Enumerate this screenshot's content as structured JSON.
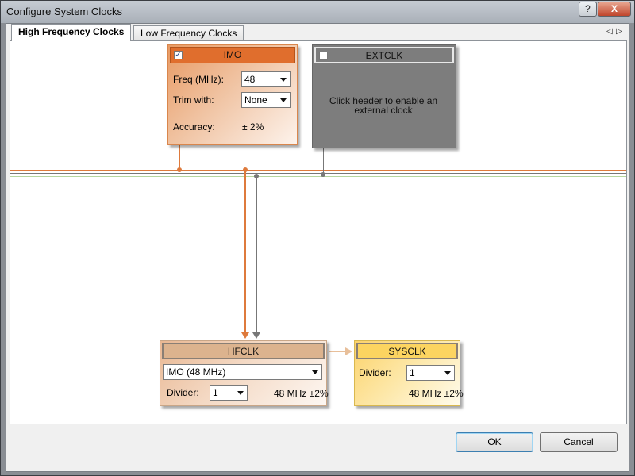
{
  "window": {
    "title": "Configure System Clocks",
    "help_label": "?",
    "close_label": "X"
  },
  "tabs": [
    {
      "label": "High Frequency Clocks",
      "active": true
    },
    {
      "label": "Low Frequency Clocks",
      "active": false
    }
  ],
  "tab_nav": {
    "prev_label": "◁",
    "next_label": "▷"
  },
  "imo": {
    "title": "IMO",
    "enabled": true,
    "checkbox_glyph": "✓",
    "freq_label": "Freq (MHz):",
    "freq_value": "48",
    "trim_label": "Trim with:",
    "trim_value": "None",
    "accuracy_label": "Accuracy:",
    "accuracy_value": "± 2%"
  },
  "extclk": {
    "title": "EXTCLK",
    "enabled": false,
    "message": "Click header to enable an external clock"
  },
  "hfclk": {
    "title": "HFCLK",
    "source_value": "IMO (48 MHz)",
    "divider_label": "Divider:",
    "divider_value": "1",
    "freq_text": "48 MHz ±2%"
  },
  "sysclk": {
    "title": "SYSCLK",
    "divider_label": "Divider:",
    "divider_value": "1",
    "freq_text": "48 MHz ±2%"
  },
  "buttons": {
    "ok_label": "OK",
    "cancel_label": "Cancel"
  },
  "colors": {
    "imo_line": "#de7a3c",
    "extclk_line": "#777777",
    "ilo_line": "#b5d69d",
    "flow_arrow": "#e8bf9a"
  }
}
